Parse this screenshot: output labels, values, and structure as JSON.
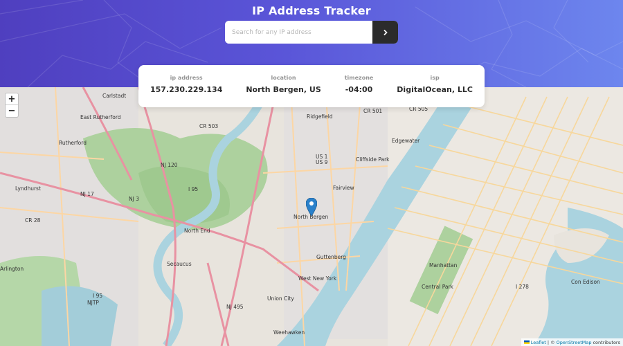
{
  "header": {
    "title": "IP Address Tracker",
    "search_placeholder": "Search for any IP address",
    "submit_icon": "chevron-right-icon"
  },
  "info": {
    "ip_label": "ip address",
    "ip_value": "157.230.229.134",
    "location_label": "location",
    "location_value": "North Bergen, US",
    "timezone_label": "timezone",
    "timezone_value": "-04:00",
    "isp_label": "isp",
    "isp_value": "DigitalOcean, LLC"
  },
  "map": {
    "zoom_in": "+",
    "zoom_out": "−",
    "attribution": {
      "leaflet": "Leaflet",
      "sep": "| ©",
      "osm": "OpenStreetMap",
      "contributors": "contributors"
    },
    "labels": {
      "carlstadt": "Carlstadt",
      "east_rutherford": "East Rutherford",
      "rutherford": "Rutherford",
      "lyndhurst": "Lyndhurst",
      "north_end": "North End",
      "secaucus": "Secaucus",
      "union_city": "Union City",
      "weehawken": "Weehawken",
      "west_new_york": "West New York",
      "guttenberg": "Guttenberg",
      "north_bergen": "North Bergen",
      "fairview": "Fairview",
      "cliffside_park": "Cliffside Park",
      "edgewater": "Edgewater",
      "ridgefield": "Ridgefield",
      "manhattan": "Manhattan",
      "central_park": "Central Park",
      "arlington": "Arlington",
      "con_edison": "Con Edison",
      "cr503": "CR 503",
      "cr501": "CR 501",
      "cr505": "CR 505",
      "nj120": "NJ 120",
      "nj17": "NJ 17",
      "nj3": "NJ 3",
      "cr28": "CR 28",
      "i95a": "I 95",
      "i95b": "I 95",
      "us1": "US 1",
      "us9": "US 9",
      "nj495": "NJ 495",
      "njtp": "NJTP",
      "i278": "I 278"
    }
  },
  "colors": {
    "header_start": "#4f3fbf",
    "header_end": "#6d86ee",
    "water": "#aad3df",
    "park": "#add19e",
    "residential": "#e0dfdf",
    "motorway": "#e892a2",
    "primary_road": "#fcd6a4",
    "marker": "#2a81cb"
  }
}
